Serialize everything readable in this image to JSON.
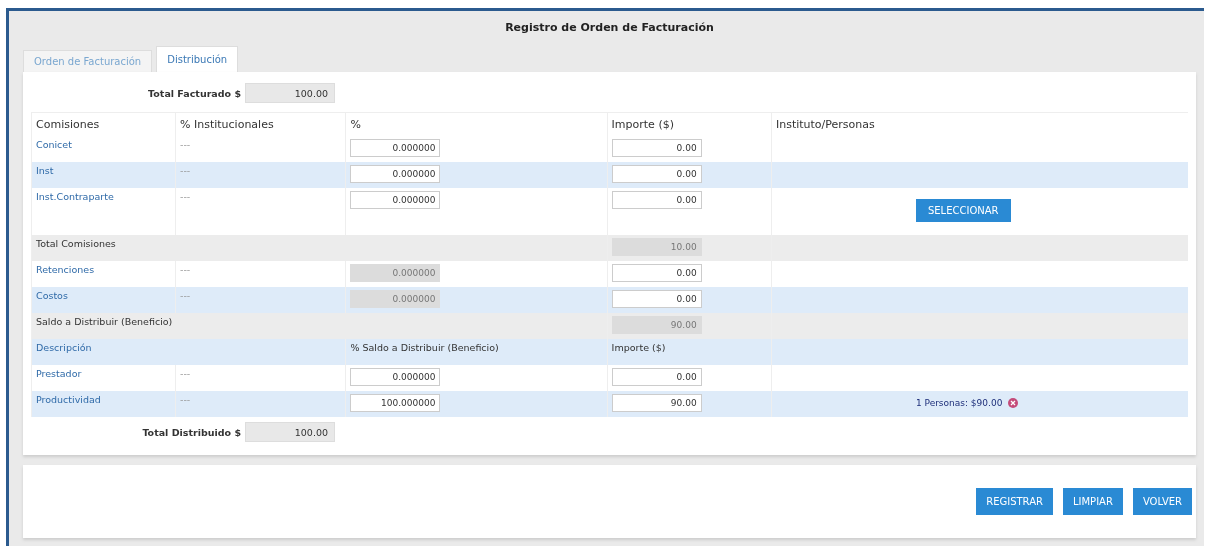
{
  "window": {
    "title": "Registro de Orden de Facturación"
  },
  "tabs": [
    {
      "label": "Orden de Facturación",
      "selected": false
    },
    {
      "label": "Distribución",
      "selected": true
    }
  ],
  "total_facturado": {
    "label": "Total Facturado $",
    "value": "100.00"
  },
  "table": {
    "columns": [
      "Comisiones",
      "% Institucionales",
      "%",
      "Importe ($)",
      "Instituto/Personas"
    ],
    "rows": [
      {
        "kind": "item",
        "name": "Conicet",
        "institucional": "---",
        "percent": "0.000000",
        "percent_disabled": false,
        "importe": "0.00"
      },
      {
        "kind": "item",
        "name": "Inst",
        "institucional": "---",
        "percent": "0.000000",
        "percent_disabled": false,
        "importe": "0.00"
      },
      {
        "kind": "item",
        "name": "Inst.Contraparte",
        "institucional": "---",
        "percent": "0.000000",
        "percent_disabled": false,
        "importe": "0.00",
        "action": "SELECCIONAR"
      },
      {
        "kind": "total",
        "name": "Total Comisiones",
        "importe": "10.00"
      },
      {
        "kind": "item",
        "name": "Retenciones",
        "institucional": "---",
        "percent": "0.000000",
        "percent_disabled": true,
        "importe": "0.00"
      },
      {
        "kind": "item",
        "name": "Costos",
        "institucional": "---",
        "percent": "0.000000",
        "percent_disabled": true,
        "importe": "0.00"
      },
      {
        "kind": "total",
        "name": "Saldo a Distribuir (Beneficio)",
        "importe": "90.00"
      },
      {
        "kind": "subheader",
        "name": "Descripción",
        "percent_label": "% Saldo a Distribuir (Beneficio)",
        "importe_label": "Importe ($)"
      },
      {
        "kind": "item",
        "name": "Prestador",
        "institucional": "---",
        "percent": "0.000000",
        "percent_disabled": false,
        "importe": "0.00"
      },
      {
        "kind": "item",
        "name": "Productividad",
        "institucional": "---",
        "percent": "100.000000",
        "percent_disabled": false,
        "importe": "90.00",
        "persons": "1 Personas: $90.00"
      }
    ]
  },
  "total_distribuido": {
    "label": "Total Distribuido $",
    "value": "100.00"
  },
  "buttons": [
    "REGISTRAR",
    "LIMPIAR",
    "VOLVER"
  ]
}
